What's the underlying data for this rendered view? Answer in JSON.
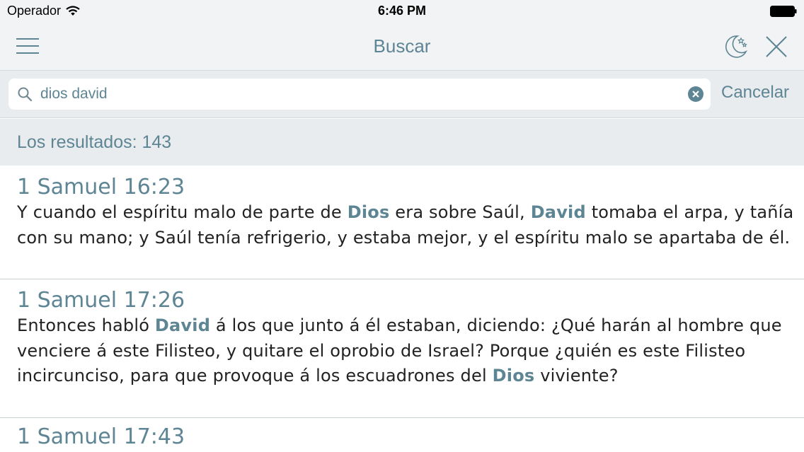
{
  "status_bar": {
    "carrier": "Operador",
    "time": "6:46 PM"
  },
  "nav": {
    "title": "Buscar",
    "icons": [
      "menu-icon",
      "night-mode-icon",
      "close-icon"
    ]
  },
  "search": {
    "query": "dios david",
    "cancel_label": "Cancelar"
  },
  "results": {
    "count_label": "Los resultados: 143",
    "items": [
      {
        "reference": "1 Samuel 16:23",
        "segments": [
          {
            "text": "Y cuando el espíritu malo de parte de ",
            "highlight": false
          },
          {
            "text": "Dios",
            "highlight": true
          },
          {
            "text": " era sobre Saúl, ",
            "highlight": false
          },
          {
            "text": "David",
            "highlight": true
          },
          {
            "text": " tomaba el arpa, y tañía con su mano; y Saúl tenía refrigerio, y estaba mejor, y el espíritu malo se apartaba de él.",
            "highlight": false
          }
        ]
      },
      {
        "reference": "1 Samuel 17:26",
        "segments": [
          {
            "text": "Entonces habló ",
            "highlight": false
          },
          {
            "text": "David",
            "highlight": true
          },
          {
            "text": " á los que junto á él estaban, diciendo: ¿Qué harán al hombre que venciere á este Filisteo, y quitare el oprobio de Israel? Porque ¿quién es este Filisteo incircunciso, para que provoque á los escuadrones del ",
            "highlight": false
          },
          {
            "text": "Dios",
            "highlight": true
          },
          {
            "text": " viviente?",
            "highlight": false
          }
        ]
      },
      {
        "reference": "1 Samuel 17:43",
        "segments": []
      }
    ]
  },
  "colors": {
    "accent": "#5e8594",
    "bar_background": "#f1f3f5",
    "search_area_background": "#e8ecef",
    "body_text": "#222222"
  }
}
